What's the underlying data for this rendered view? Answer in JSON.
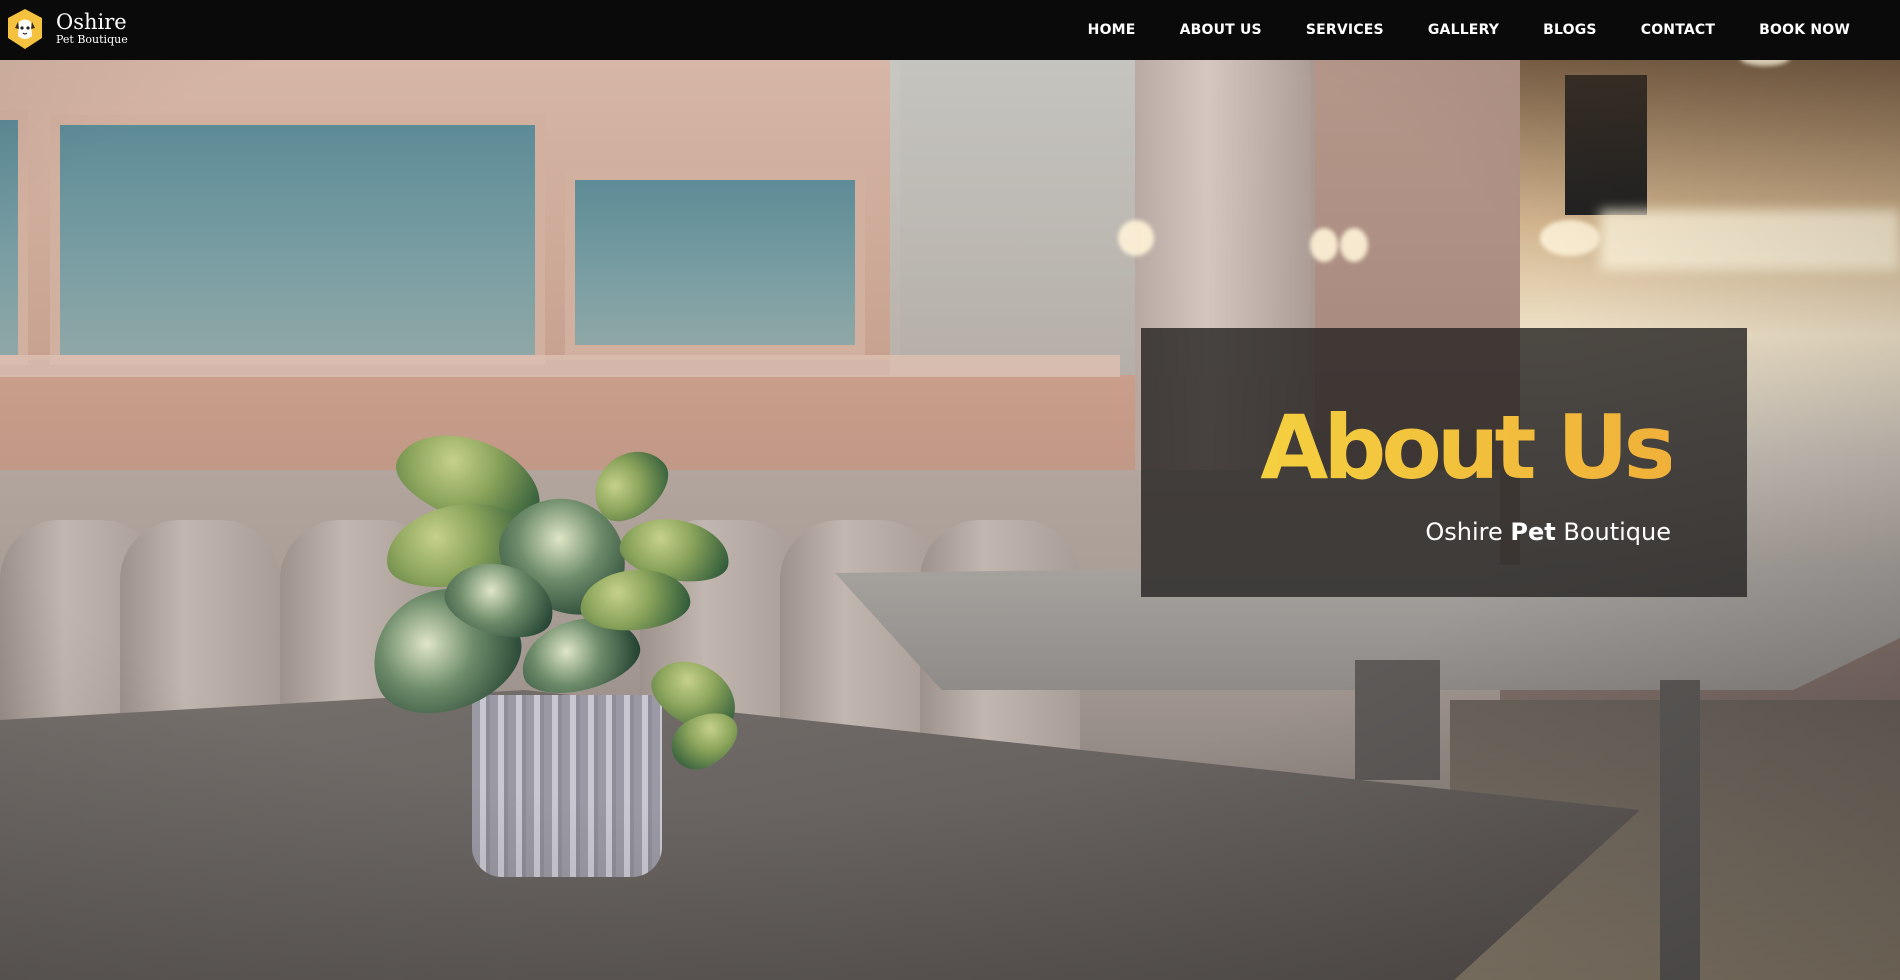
{
  "brand": {
    "name": "Oshire",
    "tagline": "Pet Boutique",
    "logo_icon": "dog-shield-logo",
    "accent_color": "#f4c23e"
  },
  "nav": {
    "items": [
      {
        "label": "HOME"
      },
      {
        "label": "ABOUT US"
      },
      {
        "label": "SERVICES"
      },
      {
        "label": "GALLERY"
      },
      {
        "label": "BLOGS"
      },
      {
        "label": "CONTACT"
      },
      {
        "label": "BOOK NOW"
      }
    ]
  },
  "hero": {
    "heading": "About Us",
    "subtitle_pre": "Oshire ",
    "subtitle_strong": "Pet",
    "subtitle_post": " Boutique",
    "heading_color": "#f4c23e"
  }
}
